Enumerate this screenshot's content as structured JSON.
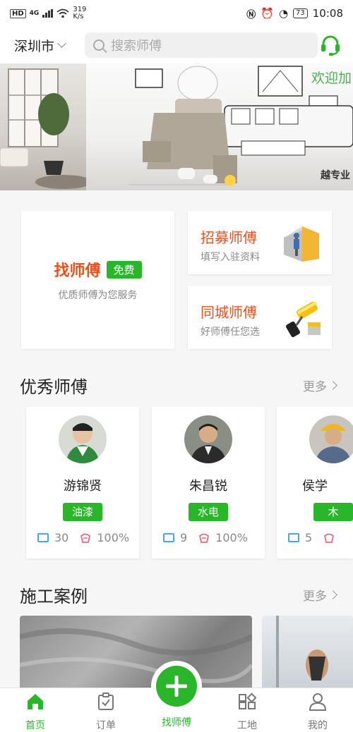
{
  "status_bar": {
    "network": "4G",
    "speed": "319",
    "speed_unit": "K/s",
    "battery": "73",
    "time": "10:08"
  },
  "header": {
    "city": "深圳市",
    "search_placeholder": "搜索师傅"
  },
  "banner": {
    "welcome": "欢迎加",
    "sub": "越专业"
  },
  "services": {
    "find": {
      "title": "找师傅",
      "badge": "免费",
      "sub": "优质师傅为您服务"
    },
    "recruit": {
      "title": "招募师傅",
      "sub": "填写入驻资料"
    },
    "local": {
      "title": "同城师傅",
      "sub": "好师傅任您选"
    }
  },
  "masters_section": {
    "title": "优秀师傅",
    "more": "更多"
  },
  "masters": [
    {
      "name": "游锦贤",
      "skill": "油漆",
      "reviews": "30",
      "rate": "100%"
    },
    {
      "name": "朱昌锐",
      "skill": "水电",
      "reviews": "9",
      "rate": "100%"
    },
    {
      "name": "侯学",
      "skill": "木",
      "reviews": "5",
      "rate": ""
    }
  ],
  "cases_section": {
    "title": "施工案例",
    "more": "更多"
  },
  "tabbar": {
    "home": "首页",
    "orders": "订单",
    "find": "找师傅",
    "site": "工地",
    "mine": "我的"
  },
  "colors": {
    "brand_green": "#2bb52b",
    "accent_orange": "#e8501c"
  }
}
